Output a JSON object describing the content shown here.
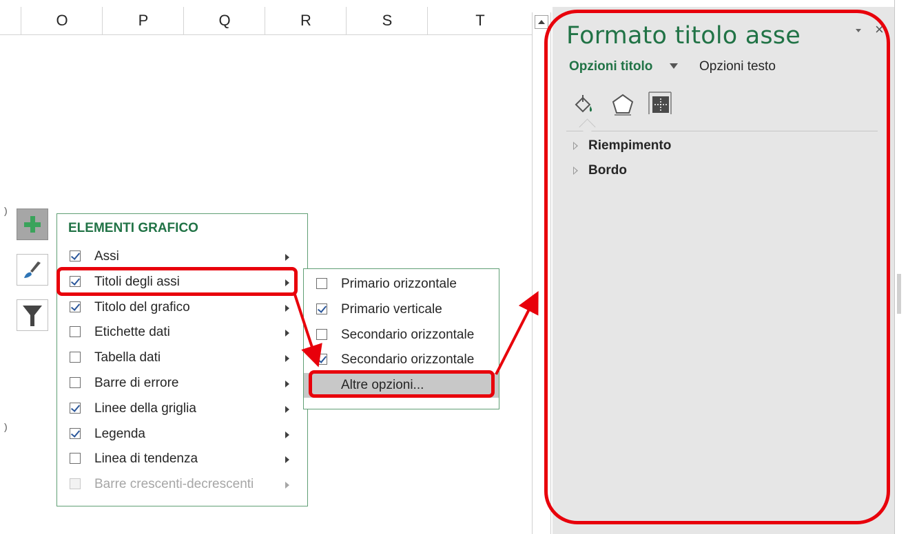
{
  "columns": [
    "O",
    "P",
    "Q",
    "R",
    "S",
    "T"
  ],
  "chart_buttons": {
    "add_element_icon": "plus-icon",
    "styles_icon": "brush-icon",
    "filters_icon": "filter-icon"
  },
  "elements_menu": {
    "title": "ELEMENTI GRAFICO",
    "items": [
      {
        "label": "Assi",
        "checked": true
      },
      {
        "label": "Titoli degli assi",
        "checked": true
      },
      {
        "label": "Titolo del grafico",
        "checked": true
      },
      {
        "label": "Etichette dati",
        "checked": false
      },
      {
        "label": "Tabella dati",
        "checked": false
      },
      {
        "label": "Barre di errore",
        "checked": false
      },
      {
        "label": "Linee della griglia",
        "checked": true
      },
      {
        "label": "Legenda",
        "checked": true
      },
      {
        "label": "Linea di tendenza",
        "checked": false
      },
      {
        "label": "Barre crescenti-decrescenti",
        "checked": false,
        "disabled": true
      }
    ]
  },
  "submenu": {
    "items": [
      {
        "label": "Primario orizzontale",
        "checked": false
      },
      {
        "label": "Primario verticale",
        "checked": true
      },
      {
        "label": "Secondario orizzontale",
        "checked": false
      },
      {
        "label": "Secondario orizzontale",
        "checked": true
      },
      {
        "label": "Altre opzioni...",
        "checked": null
      }
    ]
  },
  "pane": {
    "title": "Formato titolo asse",
    "tab_options_title": "Opzioni titolo",
    "tab_options_text": "Opzioni testo",
    "icons": [
      "fill-bucket-icon",
      "pentagon-icon",
      "size-properties-icon"
    ],
    "sections": [
      "Riempimento",
      "Bordo"
    ],
    "close_label": "×"
  },
  "colors": {
    "accent_green": "#217346",
    "annotation_red": "#e8000b",
    "pane_bg": "#e6e6e6"
  }
}
